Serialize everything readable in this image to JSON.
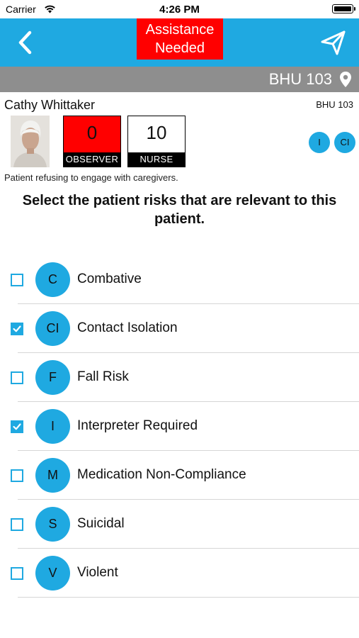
{
  "status_bar": {
    "carrier": "Carrier",
    "time": "4:26 PM",
    "wifi_icon": "wifi-icon",
    "battery_icon": "battery-icon"
  },
  "nav": {
    "back_icon": "chevron-left-icon",
    "send_icon": "paper-plane-icon",
    "assist_line1": "Assistance",
    "assist_line2": "Needed",
    "bar_color": "#1fa9e1",
    "assist_color": "#ff0000"
  },
  "location": {
    "room": "BHU 103",
    "pin_icon": "location-pin-icon"
  },
  "patient": {
    "name": "Cathy Whittaker",
    "room_small": "BHU 103",
    "note": "Patient refusing to engage with caregivers.",
    "observer": {
      "count": "0",
      "label": "OBSERVER"
    },
    "nurse": {
      "count": "10",
      "label": "NURSE"
    },
    "active_badges": [
      "I",
      "CI"
    ]
  },
  "prompt": "Select the patient risks that are relevant to this patient.",
  "risks": [
    {
      "code": "C",
      "label": "Combative",
      "checked": false
    },
    {
      "code": "CI",
      "label": "Contact Isolation",
      "checked": true
    },
    {
      "code": "F",
      "label": "Fall Risk",
      "checked": false
    },
    {
      "code": "I",
      "label": "Interpreter Required",
      "checked": true
    },
    {
      "code": "M",
      "label": "Medication Non-Compliance",
      "checked": false
    },
    {
      "code": "S",
      "label": "Suicidal",
      "checked": false
    },
    {
      "code": "V",
      "label": "Violent",
      "checked": false
    }
  ]
}
